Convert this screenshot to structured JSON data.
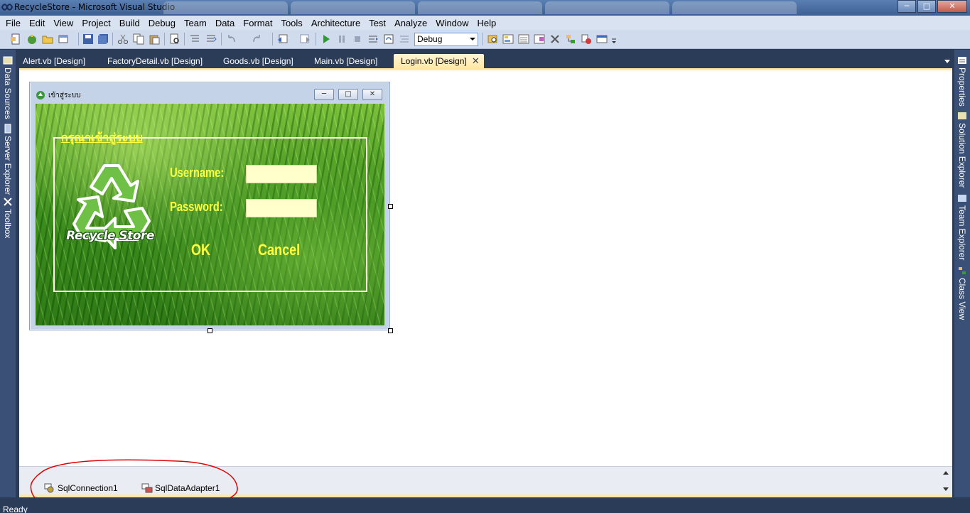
{
  "window": {
    "title": "RecycleStore - Microsoft Visual Studio",
    "minimize_glyph": "─",
    "maximize_glyph": "□",
    "close_glyph": "✕"
  },
  "menu": [
    "File",
    "Edit",
    "View",
    "Project",
    "Build",
    "Debug",
    "Team",
    "Data",
    "Format",
    "Tools",
    "Architecture",
    "Test",
    "Analyze",
    "Window",
    "Help"
  ],
  "toolbar": {
    "configuration": "Debug"
  },
  "left_panels": [
    "Data Sources",
    "Server Explorer",
    "Toolbox"
  ],
  "right_panels": [
    "Properties",
    "Solution Explorer",
    "Team Explorer",
    "Class View"
  ],
  "doc_tabs": [
    "Alert.vb [Design]",
    "FactoryDetail.vb [Design]",
    "Goods.vb [Design]",
    "Main.vb [Design]",
    "Login.vb [Design]"
  ],
  "active_tab_close": "✕",
  "login_form": {
    "title": "เข้าสู่ระบบ",
    "group_title": "กรุณาเข้าสู่ระบบ",
    "logo_text": "Recycle Store",
    "username_label": "Username:",
    "password_label": "Password:",
    "ok_label": "OK",
    "cancel_label": "Cancel"
  },
  "component_tray": [
    "SqlConnection1",
    "SqlDataAdapter1"
  ],
  "status": "Ready",
  "colors": {
    "ide_dark": "#2b3c59",
    "active_tab": "#ffe8a6",
    "form_label_yellow": "#ffff40",
    "annotation_red": "#e00000"
  }
}
